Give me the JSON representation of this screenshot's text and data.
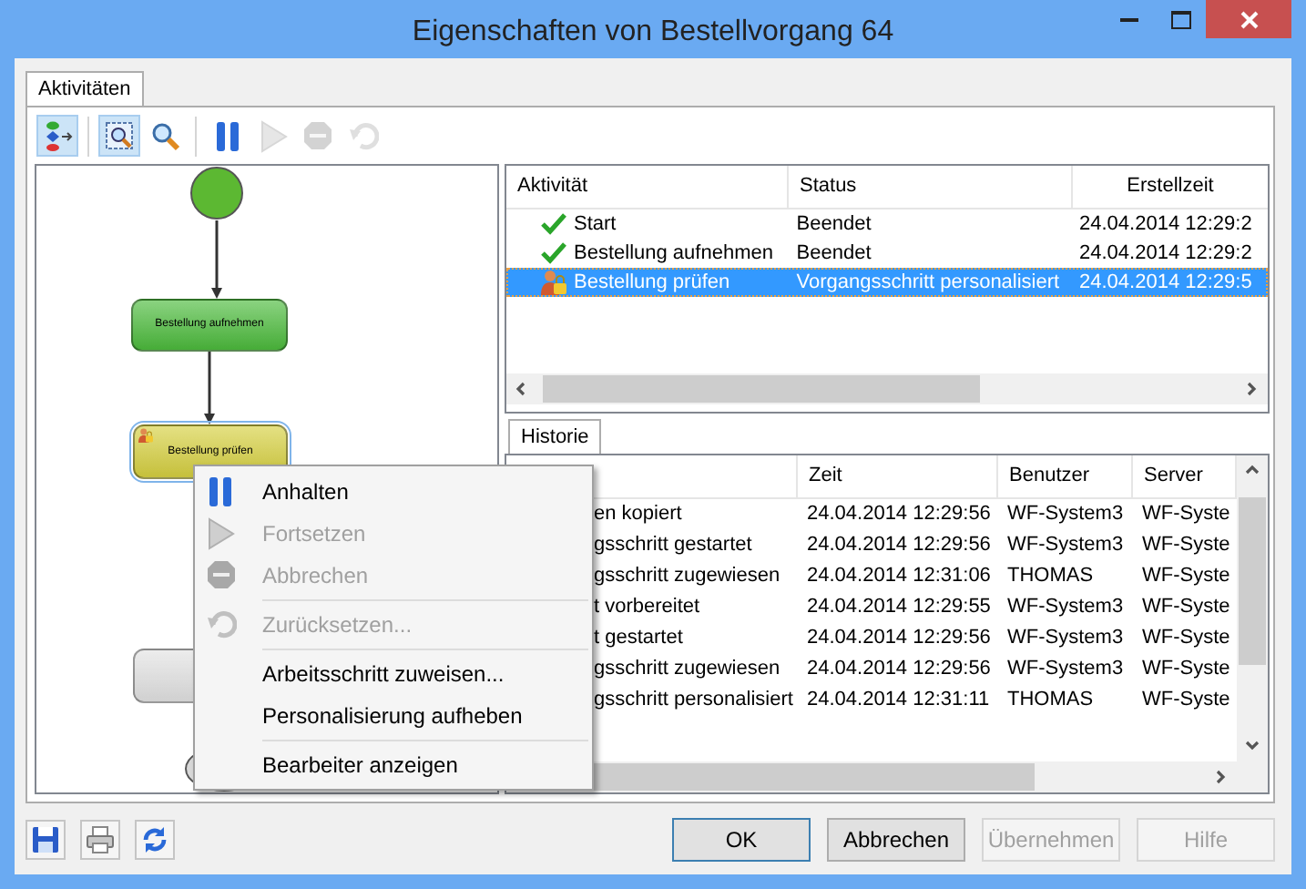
{
  "window": {
    "title": "Eigenschaften von Bestellvorgang 64"
  },
  "tabs": [
    {
      "label": "Aktivitäten",
      "selected": true
    }
  ],
  "toolbar": [
    {
      "kind": "button",
      "pressed": true,
      "disabled": false
    },
    {
      "kind": "separator"
    },
    {
      "kind": "button",
      "pressed": true,
      "disabled": false
    },
    {
      "kind": "button",
      "pressed": false,
      "disabled": false
    },
    {
      "kind": "separator"
    },
    {
      "kind": "button",
      "pressed": false,
      "disabled": false
    },
    {
      "kind": "button",
      "pressed": false,
      "disabled": true
    },
    {
      "kind": "button",
      "pressed": false,
      "disabled": true
    },
    {
      "kind": "button",
      "pressed": false,
      "disabled": true
    }
  ],
  "diagram": {
    "nodes": [
      {
        "kind": "start",
        "color": "#5cb832"
      },
      {
        "kind": "task",
        "label": "Bestellung aufnehmen",
        "color": "#4cbb3c",
        "selected": false
      },
      {
        "kind": "task",
        "label": "Bestellung prüfen",
        "color": "#d6d040",
        "selected": true
      },
      {
        "kind": "task",
        "color": "#e2e2e2",
        "selected": false
      },
      {
        "kind": "end"
      }
    ]
  },
  "activities": {
    "columns": [
      "Aktivität",
      "Status",
      "Erstellzeit"
    ],
    "rows": [
      {
        "kind": "done",
        "selected": false,
        "cells": [
          "Start",
          "Beendet",
          "24.04.2014 12:29:2"
        ]
      },
      {
        "kind": "done",
        "selected": false,
        "cells": [
          "Bestellung aufnehmen",
          "Beendet",
          "24.04.2014 12:29:2"
        ]
      },
      {
        "kind": "personalized",
        "selected": true,
        "cells": [
          "Bestellung prüfen",
          "Vorgangsschritt personalisiert",
          "24.04.2014 12:29:5"
        ]
      }
    ]
  },
  "history_tabs": [
    {
      "label": "Historie",
      "selected": true
    }
  ],
  "history": {
    "columns": [
      "",
      "Zeit",
      "Benutzer",
      "Server"
    ],
    "rows": [
      {
        "cells": [
          "en kopiert",
          "24.04.2014 12:29:56",
          "WF-System3",
          "WF-Syste"
        ]
      },
      {
        "cells": [
          "gsschritt gestartet",
          "24.04.2014 12:29:56",
          "WF-System3",
          "WF-Syste"
        ]
      },
      {
        "cells": [
          "gsschritt zugewiesen",
          "24.04.2014 12:31:06",
          "THOMAS",
          "WF-Syste"
        ]
      },
      {
        "cells": [
          "t vorbereitet",
          "24.04.2014 12:29:55",
          "WF-System3",
          "WF-Syste"
        ]
      },
      {
        "cells": [
          "t gestartet",
          "24.04.2014 12:29:56",
          "WF-System3",
          "WF-Syste"
        ]
      },
      {
        "cells": [
          "gsschritt zugewiesen",
          "24.04.2014 12:29:56",
          "WF-System3",
          "WF-Syste"
        ]
      },
      {
        "cells": [
          "gsschritt personalisiert",
          "24.04.2014 12:31:11",
          "THOMAS",
          "WF-Syste"
        ]
      }
    ]
  },
  "context_menu": {
    "items": [
      {
        "kind": "item",
        "label": "Anhalten",
        "disabled": false
      },
      {
        "kind": "item",
        "label": "Fortsetzen",
        "disabled": true
      },
      {
        "kind": "item",
        "label": "Abbrechen",
        "disabled": true
      },
      {
        "kind": "separator"
      },
      {
        "kind": "item",
        "label": "Zurücksetzen...",
        "disabled": true
      },
      {
        "kind": "separator"
      },
      {
        "kind": "item",
        "label": "Arbeitsschritt zuweisen...",
        "disabled": false
      },
      {
        "kind": "item",
        "label": "Personalisierung aufheben",
        "disabled": false
      },
      {
        "kind": "separator"
      },
      {
        "kind": "item",
        "label": "Bearbeiter anzeigen",
        "disabled": false
      }
    ]
  },
  "footer_buttons": [
    {
      "label": "OK",
      "default": true,
      "disabled": false
    },
    {
      "label": "Abbrechen",
      "default": false,
      "disabled": false
    },
    {
      "label": "Übernehmen",
      "default": false,
      "disabled": true
    },
    {
      "label": "Hilfe",
      "default": false,
      "disabled": true
    }
  ]
}
